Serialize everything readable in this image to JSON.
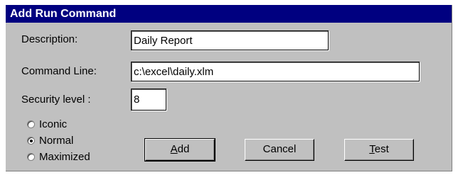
{
  "dialog": {
    "title": "Add Run Command",
    "fields": {
      "description": {
        "label": "Description:",
        "value": "Daily Report"
      },
      "command_line": {
        "label": "Command Line:",
        "value": "c:\\excel\\daily.xlm"
      },
      "security": {
        "label": "Security level :",
        "value": "8"
      }
    },
    "window_state": {
      "options": [
        "Iconic",
        "Normal",
        "Maximized"
      ],
      "selected": "Normal"
    },
    "buttons": {
      "add": {
        "mnemonic": "A",
        "rest": "dd"
      },
      "cancel": {
        "label": "Cancel"
      },
      "test": {
        "mnemonic": "T",
        "rest": "est"
      }
    }
  }
}
